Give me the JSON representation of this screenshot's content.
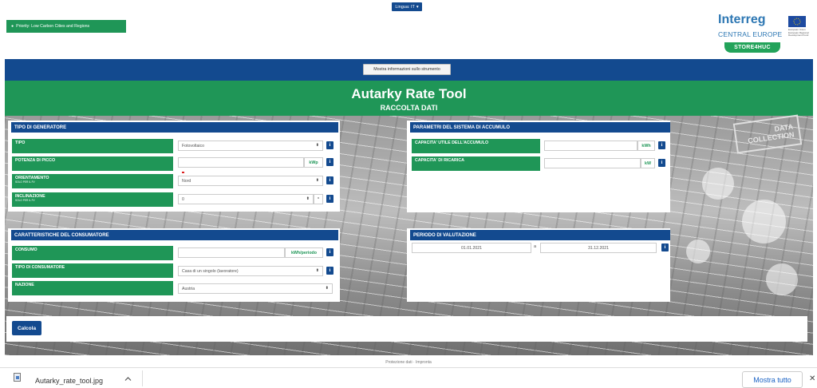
{
  "top": {
    "language_button": "Lingua: IT",
    "priority_label": "Priority: Low Carbon Cities and Regions"
  },
  "logo": {
    "brand": "Interreg",
    "region": "CENTRAL EUROPE",
    "eu_caption": "European Union European Regional Development Fund",
    "project": "STORE4HUC"
  },
  "header": {
    "info_button": "Mostra informazioni sullo strumento",
    "title": "Autarky Rate Tool",
    "subtitle": "RACCOLTA DATI"
  },
  "stamp": {
    "line1": "DATA",
    "line2": "COLLECTION"
  },
  "generator": {
    "heading": "TIPO DI GENERATORE",
    "tipo_label": "TIPO",
    "tipo_value": "Fotovoltaico",
    "potenza_label": "POTENZA DI PICCO",
    "potenza_unit": "kWp",
    "orient_label": "ORIENTAMENTO",
    "orient_note": "SOLO PER IL FV",
    "orient_value": "Nord",
    "incl_label": "INCLINAZIONE",
    "incl_note": "SOLO PER IL FV",
    "incl_value": "0",
    "incl_unit": "°"
  },
  "storage": {
    "heading": "PARAMETRI DEL SISTEMA DI ACCUMULO",
    "cap_label": "CAPACITA' UTILE DELL'ACCUMULO",
    "cap_unit": "kWh",
    "charge_label": "CAPACITA' DI RICARICA",
    "charge_unit": "kW"
  },
  "consumer": {
    "heading": "CARATTERISTICHE DEL CONSUMATORE",
    "consumo_label": "CONSUMO",
    "consumo_unit": "kWh/periodo",
    "type_label": "TIPO DI CONSUMATORE",
    "type_value": "Casa di un singolo (lavoratore)",
    "nation_label": "NAZIONE",
    "nation_value": "Austria"
  },
  "period": {
    "heading": "PERIODO DI VALUTAZIONE",
    "start": "01.01.2021",
    "separator": "a",
    "end": "31.12.2021"
  },
  "actions": {
    "calculate": "Calcola"
  },
  "footer": {
    "text": "Protezione dati · Impronta"
  },
  "download_bar": {
    "filename": "Autarky_rate_tool.jpg",
    "show_all": "Mostra tutto",
    "close": "✕"
  },
  "info_glyph": "i",
  "select_arrow": "⬍",
  "colors": {
    "blue": "#134a8f",
    "green": "#1f9657"
  }
}
